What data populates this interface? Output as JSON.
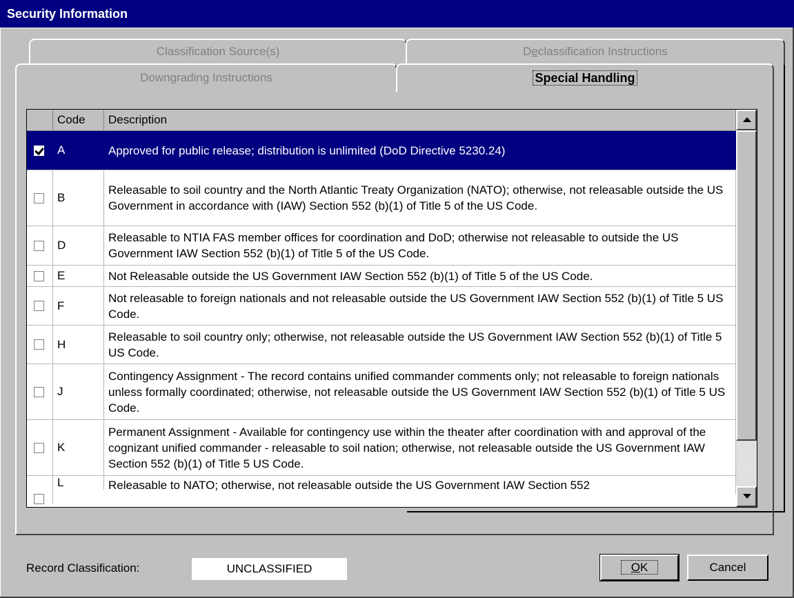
{
  "window": {
    "title": "Security Information"
  },
  "tabs": {
    "classification_sources": "Classification Source(s)",
    "declassification_prefix": "D",
    "declassification_underline": "e",
    "declassification_rest": "classification Instructions",
    "downgrading_prefix": "Down",
    "downgrading_underline": "g",
    "downgrading_rest": "rading Instructions",
    "special_handling": "Special Handling"
  },
  "grid": {
    "columns": [
      "",
      "Code",
      "Description"
    ],
    "rows": [
      {
        "checked": true,
        "code": "A",
        "description": "Approved for public release; distribution is unlimited (DoD Directive 5230.24)"
      },
      {
        "checked": false,
        "code": "B",
        "description": "Releasable to soil country and the North Atlantic Treaty Organization (NATO); otherwise, not releasable outside the US Government in accordance with (IAW) Section 552 (b)(1) of Title 5 of the US Code."
      },
      {
        "checked": false,
        "code": "D",
        "description": "Releasable to NTIA FAS member offices for coordination and DoD; otherwise not releasable to outside the US Government IAW Section 552 (b)(1) of Title 5 of the US Code."
      },
      {
        "checked": false,
        "code": "E",
        "description": "Not Releasable outside the US Government IAW Section 552 (b)(1) of Title 5 of the US Code."
      },
      {
        "checked": false,
        "code": "F",
        "description": "Not releasable to foreign nationals and not releasable outside the US Government IAW Section 552 (b)(1) of Title 5 US Code."
      },
      {
        "checked": false,
        "code": "H",
        "description": "Releasable to soil country only; otherwise, not releasable outside the US Government IAW Section 552 (b)(1) of Title 5 US Code."
      },
      {
        "checked": false,
        "code": "J",
        "description": "Contingency Assignment - The record contains unified commander comments only; not releasable to foreign nationals unless formally coordinated; otherwise, not releasable outside the US Government IAW Section 552 (b)(1) of Title 5 US Code."
      },
      {
        "checked": false,
        "code": "K",
        "description": "Permanent Assignment - Available for contingency use within the theater after coordination with and approval of the cognizant unified commander - releasable to soil nation; otherwise, not releasable outside the US Government IAW Section 552 (b)(1) of Title 5 US Code."
      },
      {
        "checked": false,
        "code": "L",
        "description": "Releasable to NATO; otherwise, not releasable outside the US Government IAW Section 552"
      }
    ]
  },
  "footer": {
    "record_classification_label": "Record Classification:",
    "record_classification_value": "UNCLASSIFIED",
    "ok_label": "OK",
    "ok_underline": "O",
    "ok_rest": "K",
    "cancel_label": "Cancel"
  },
  "colors": {
    "title_bar": "#000080",
    "selection": "#000080",
    "face": "#c0c0c0"
  }
}
